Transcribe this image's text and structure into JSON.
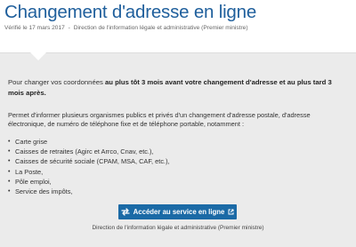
{
  "header": {
    "title": "Changement d'adresse en ligne",
    "verified": "Vérifié le 17 mars 2017",
    "separator": "-",
    "source": "Direction de l'information légale et administrative (Premier ministre)"
  },
  "card": {
    "lead_before": "Pour changer vos coordonnées ",
    "lead_bold": "au plus tôt 3 mois avant votre changement d'adresse et au plus tard 3 mois après.",
    "description": "Permet d'informer plusieurs organismes publics et privés d'un changement d'adresse postale, d'adresse électronique, de numéro de téléphone fixe et de téléphone portable, notamment :",
    "bullet_glyph": "•",
    "items": [
      "Carte grise",
      "Caisses de retraites (Agirc et Arrco, Cnav, etc.),",
      "Caisses de sécurité sociale (CPAM, MSA, CAF, etc.),",
      "La Poste,",
      "Pôle emploi,",
      "Service des impôts,"
    ],
    "cta_label": "Accéder au service en ligne",
    "cta_icon": "swap-arrows-icon",
    "cta_external_icon": "external-link-icon",
    "provider": "Direction de l'information légale et administrative (Premier ministre)"
  },
  "colors": {
    "title": "#1f5f9c",
    "card_background": "#ebebeb",
    "button": "#1b6aa6",
    "button_text": "#ffffff"
  }
}
